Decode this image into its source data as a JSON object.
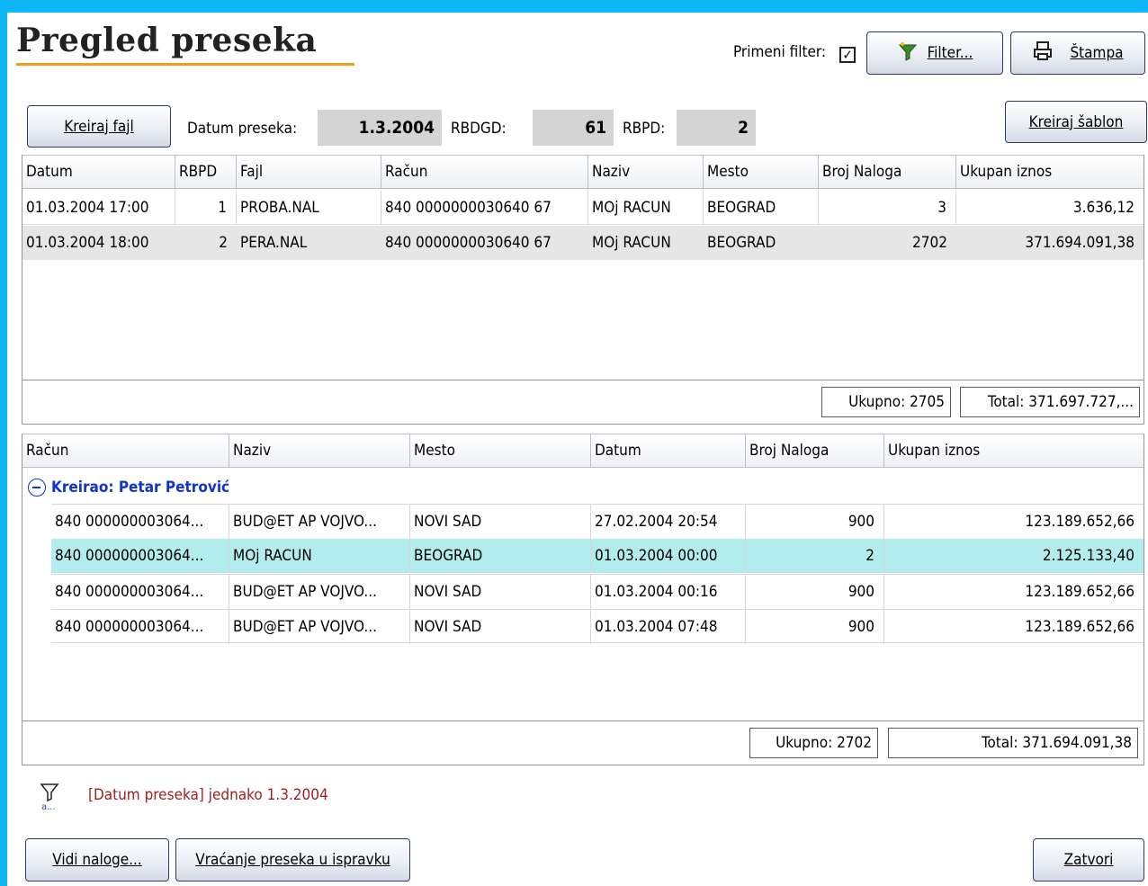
{
  "window": {
    "title": "Pregled preseka"
  },
  "toolbar": {
    "filter_label": "Primeni filter:",
    "filter_checked": true,
    "filter_button": "Filter...",
    "print_button": "Štampa"
  },
  "header": {
    "create_file_button": "Kreiraj fajl",
    "date_label": "Datum preseka:",
    "date_value": "1.3.2004",
    "rbdgd_label": "RBDGD:",
    "rbdgd_value": "61",
    "rbpd_label": "RBPD:",
    "rbpd_value": "2",
    "create_template_button": "Kreiraj šablon"
  },
  "top_grid": {
    "columns": [
      "Datum",
      "RBPD",
      "Fajl",
      "Račun",
      "Naziv",
      "Mesto",
      "Broj Naloga",
      "Ukupan iznos"
    ],
    "rows": [
      [
        "01.03.2004 17:00",
        "1",
        "PROBA.NAL",
        "840 0000000030640 67",
        "MOj RACUN",
        "BEOGRAD",
        "3",
        "3.636,12"
      ],
      [
        "01.03.2004 18:00",
        "2",
        "PERA.NAL",
        "840 0000000030640 67",
        "MOj RACUN",
        "BEOGRAD",
        "2702",
        "371.694.091,38"
      ]
    ],
    "summary_count": "Ukupno: 2705",
    "summary_total": "Total: 371.697.727,..."
  },
  "bottom_grid": {
    "columns": [
      "Račun",
      "Naziv",
      "Mesto",
      "Datum",
      "Broj Naloga",
      "Ukupan iznos"
    ],
    "group_label": "Kreirao: Petar Petrović",
    "rows": [
      [
        "840  000000003064...",
        "BUD@ET  AP  VOJVO...",
        "NOVI SAD",
        "27.02.2004 20:54",
        "900",
        "123.189.652,66"
      ],
      [
        "840  000000003064...",
        "MOj RACUN",
        "BEOGRAD",
        "01.03.2004 00:00",
        "2",
        "2.125.133,40"
      ],
      [
        "840  000000003064...",
        "BUD@ET  AP  VOJVO...",
        "NOVI SAD",
        "01.03.2004 00:16",
        "900",
        "123.189.652,66"
      ],
      [
        "840  000000003064...",
        "BUD@ET  AP  VOJVO...",
        "NOVI SAD",
        "01.03.2004 07:48",
        "900",
        "123.189.652,66"
      ]
    ],
    "summary_count": "Ukupno: 2702",
    "summary_total": "Total: 371.694.091,38"
  },
  "filter_bar": {
    "text": "[Datum preseka] jednako 1.3.2004",
    "icon": "filter-icon"
  },
  "actions": {
    "view_orders_button": "Vidi naloge...",
    "return_button": "Vraćanje preseka u ispravku",
    "close_button": "Zatvori"
  },
  "colors": {
    "frame": "#10b7f5",
    "title_underline": "#f39a1f",
    "group_header": "#1133cc",
    "selected_row": "#b3ecec",
    "alt_row": "#e6e6e6",
    "filter_text": "#a02020"
  }
}
